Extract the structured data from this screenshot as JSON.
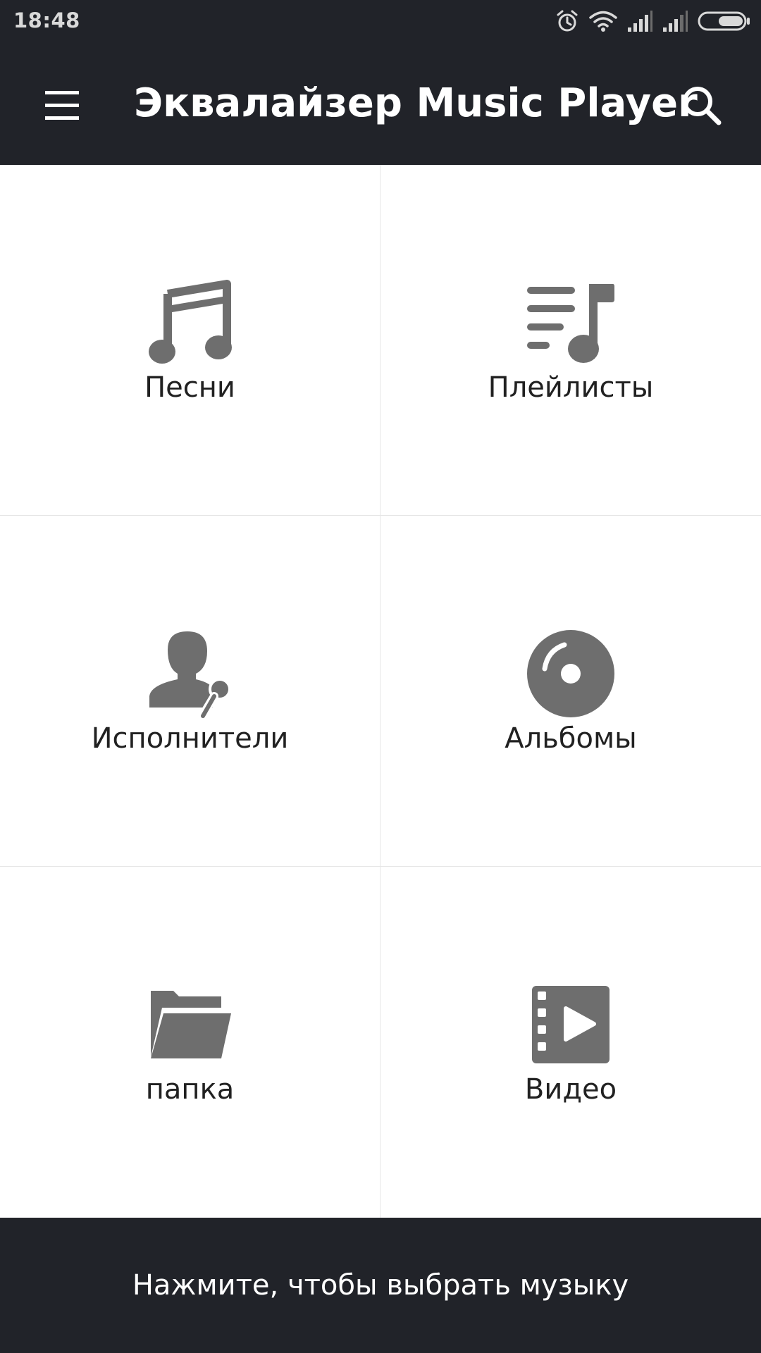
{
  "status_bar": {
    "time": "18:48",
    "icons": [
      "alarm-icon",
      "wifi-icon",
      "signal-icon",
      "signal-icon",
      "battery-icon"
    ]
  },
  "app_bar": {
    "title": "Эквалайзер Music Player",
    "menu_icon": "menu-icon",
    "search_icon": "search-icon"
  },
  "grid": {
    "tiles": [
      {
        "label": "Песни",
        "icon": "music-note-icon"
      },
      {
        "label": "Плейлисты",
        "icon": "playlist-icon"
      },
      {
        "label": "Исполнители",
        "icon": "artist-microphone-icon"
      },
      {
        "label": "Альбомы",
        "icon": "album-disc-icon"
      },
      {
        "label": "папка",
        "icon": "folder-icon"
      },
      {
        "label": "Видео",
        "icon": "video-icon"
      }
    ]
  },
  "bottom_bar": {
    "text": "Нажмите, чтобы выбрать музыку"
  },
  "colors": {
    "bar_background": "#212329",
    "icon_gray": "#6e6e6e",
    "label_text": "#212121"
  }
}
